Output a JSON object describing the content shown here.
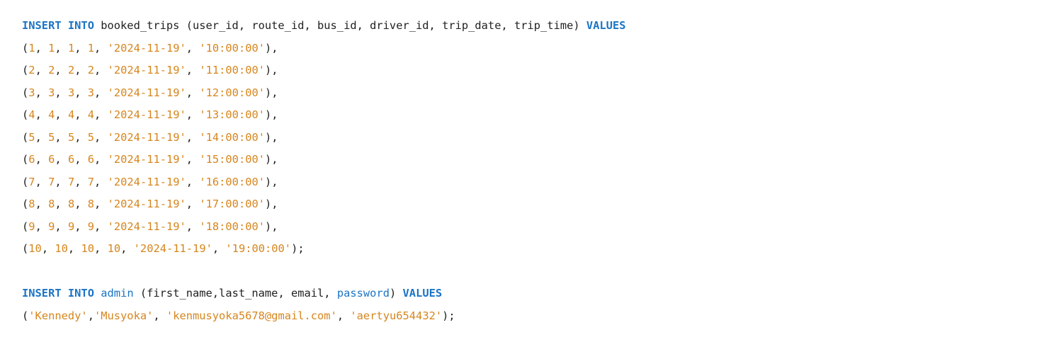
{
  "editor": {
    "lines": [
      [
        {
          "t": "INSERT",
          "k": "kw"
        },
        {
          "t": " ",
          "k": "plain"
        },
        {
          "t": "INTO",
          "k": "kw"
        },
        {
          "t": " booked_trips (user_id, route_id, bus_id, driver_id, trip_date, trip_time) ",
          "k": "plain"
        },
        {
          "t": "VALUES",
          "k": "kw"
        }
      ],
      [
        {
          "t": "(",
          "k": "punc"
        },
        {
          "t": "1",
          "k": "num"
        },
        {
          "t": ", ",
          "k": "punc"
        },
        {
          "t": "1",
          "k": "num"
        },
        {
          "t": ", ",
          "k": "punc"
        },
        {
          "t": "1",
          "k": "num"
        },
        {
          "t": ", ",
          "k": "punc"
        },
        {
          "t": "1",
          "k": "num"
        },
        {
          "t": ", ",
          "k": "punc"
        },
        {
          "t": "'2024-11-19'",
          "k": "str"
        },
        {
          "t": ", ",
          "k": "punc"
        },
        {
          "t": "'10:00:00'",
          "k": "str"
        },
        {
          "t": "),",
          "k": "punc"
        }
      ],
      [
        {
          "t": "(",
          "k": "punc"
        },
        {
          "t": "2",
          "k": "num"
        },
        {
          "t": ", ",
          "k": "punc"
        },
        {
          "t": "2",
          "k": "num"
        },
        {
          "t": ", ",
          "k": "punc"
        },
        {
          "t": "2",
          "k": "num"
        },
        {
          "t": ", ",
          "k": "punc"
        },
        {
          "t": "2",
          "k": "num"
        },
        {
          "t": ", ",
          "k": "punc"
        },
        {
          "t": "'2024-11-19'",
          "k": "str"
        },
        {
          "t": ", ",
          "k": "punc"
        },
        {
          "t": "'11:00:00'",
          "k": "str"
        },
        {
          "t": "),",
          "k": "punc"
        }
      ],
      [
        {
          "t": "(",
          "k": "punc"
        },
        {
          "t": "3",
          "k": "num"
        },
        {
          "t": ", ",
          "k": "punc"
        },
        {
          "t": "3",
          "k": "num"
        },
        {
          "t": ", ",
          "k": "punc"
        },
        {
          "t": "3",
          "k": "num"
        },
        {
          "t": ", ",
          "k": "punc"
        },
        {
          "t": "3",
          "k": "num"
        },
        {
          "t": ", ",
          "k": "punc"
        },
        {
          "t": "'2024-11-19'",
          "k": "str"
        },
        {
          "t": ", ",
          "k": "punc"
        },
        {
          "t": "'12:00:00'",
          "k": "str"
        },
        {
          "t": "),",
          "k": "punc"
        }
      ],
      [
        {
          "t": "(",
          "k": "punc"
        },
        {
          "t": "4",
          "k": "num"
        },
        {
          "t": ", ",
          "k": "punc"
        },
        {
          "t": "4",
          "k": "num"
        },
        {
          "t": ", ",
          "k": "punc"
        },
        {
          "t": "4",
          "k": "num"
        },
        {
          "t": ", ",
          "k": "punc"
        },
        {
          "t": "4",
          "k": "num"
        },
        {
          "t": ", ",
          "k": "punc"
        },
        {
          "t": "'2024-11-19'",
          "k": "str"
        },
        {
          "t": ", ",
          "k": "punc"
        },
        {
          "t": "'13:00:00'",
          "k": "str"
        },
        {
          "t": "),",
          "k": "punc"
        }
      ],
      [
        {
          "t": "(",
          "k": "punc"
        },
        {
          "t": "5",
          "k": "num"
        },
        {
          "t": ", ",
          "k": "punc"
        },
        {
          "t": "5",
          "k": "num"
        },
        {
          "t": ", ",
          "k": "punc"
        },
        {
          "t": "5",
          "k": "num"
        },
        {
          "t": ", ",
          "k": "punc"
        },
        {
          "t": "5",
          "k": "num"
        },
        {
          "t": ", ",
          "k": "punc"
        },
        {
          "t": "'2024-11-19'",
          "k": "str"
        },
        {
          "t": ", ",
          "k": "punc"
        },
        {
          "t": "'14:00:00'",
          "k": "str"
        },
        {
          "t": "),",
          "k": "punc"
        }
      ],
      [
        {
          "t": "(",
          "k": "punc"
        },
        {
          "t": "6",
          "k": "num"
        },
        {
          "t": ", ",
          "k": "punc"
        },
        {
          "t": "6",
          "k": "num"
        },
        {
          "t": ", ",
          "k": "punc"
        },
        {
          "t": "6",
          "k": "num"
        },
        {
          "t": ", ",
          "k": "punc"
        },
        {
          "t": "6",
          "k": "num"
        },
        {
          "t": ", ",
          "k": "punc"
        },
        {
          "t": "'2024-11-19'",
          "k": "str"
        },
        {
          "t": ", ",
          "k": "punc"
        },
        {
          "t": "'15:00:00'",
          "k": "str"
        },
        {
          "t": "),",
          "k": "punc"
        }
      ],
      [
        {
          "t": "(",
          "k": "punc"
        },
        {
          "t": "7",
          "k": "num"
        },
        {
          "t": ", ",
          "k": "punc"
        },
        {
          "t": "7",
          "k": "num"
        },
        {
          "t": ", ",
          "k": "punc"
        },
        {
          "t": "7",
          "k": "num"
        },
        {
          "t": ", ",
          "k": "punc"
        },
        {
          "t": "7",
          "k": "num"
        },
        {
          "t": ", ",
          "k": "punc"
        },
        {
          "t": "'2024-11-19'",
          "k": "str"
        },
        {
          "t": ", ",
          "k": "punc"
        },
        {
          "t": "'16:00:00'",
          "k": "str"
        },
        {
          "t": "),",
          "k": "punc"
        }
      ],
      [
        {
          "t": "(",
          "k": "punc"
        },
        {
          "t": "8",
          "k": "num"
        },
        {
          "t": ", ",
          "k": "punc"
        },
        {
          "t": "8",
          "k": "num"
        },
        {
          "t": ", ",
          "k": "punc"
        },
        {
          "t": "8",
          "k": "num"
        },
        {
          "t": ", ",
          "k": "punc"
        },
        {
          "t": "8",
          "k": "num"
        },
        {
          "t": ", ",
          "k": "punc"
        },
        {
          "t": "'2024-11-19'",
          "k": "str"
        },
        {
          "t": ", ",
          "k": "punc"
        },
        {
          "t": "'17:00:00'",
          "k": "str"
        },
        {
          "t": "),",
          "k": "punc"
        }
      ],
      [
        {
          "t": "(",
          "k": "punc"
        },
        {
          "t": "9",
          "k": "num"
        },
        {
          "t": ", ",
          "k": "punc"
        },
        {
          "t": "9",
          "k": "num"
        },
        {
          "t": ", ",
          "k": "punc"
        },
        {
          "t": "9",
          "k": "num"
        },
        {
          "t": ", ",
          "k": "punc"
        },
        {
          "t": "9",
          "k": "num"
        },
        {
          "t": ", ",
          "k": "punc"
        },
        {
          "t": "'2024-11-19'",
          "k": "str"
        },
        {
          "t": ", ",
          "k": "punc"
        },
        {
          "t": "'18:00:00'",
          "k": "str"
        },
        {
          "t": "),",
          "k": "punc"
        }
      ],
      [
        {
          "t": "(",
          "k": "punc"
        },
        {
          "t": "10",
          "k": "num"
        },
        {
          "t": ", ",
          "k": "punc"
        },
        {
          "t": "10",
          "k": "num"
        },
        {
          "t": ", ",
          "k": "punc"
        },
        {
          "t": "10",
          "k": "num"
        },
        {
          "t": ", ",
          "k": "punc"
        },
        {
          "t": "10",
          "k": "num"
        },
        {
          "t": ", ",
          "k": "punc"
        },
        {
          "t": "'2024-11-19'",
          "k": "str"
        },
        {
          "t": ", ",
          "k": "punc"
        },
        {
          "t": "'19:00:00'",
          "k": "str"
        },
        {
          "t": ");",
          "k": "punc"
        }
      ],
      [],
      [
        {
          "t": "INSERT",
          "k": "kw"
        },
        {
          "t": " ",
          "k": "plain"
        },
        {
          "t": "INTO",
          "k": "kw"
        },
        {
          "t": " ",
          "k": "plain"
        },
        {
          "t": "admin",
          "k": "id"
        },
        {
          "t": " (first_name,last_name, email, ",
          "k": "plain"
        },
        {
          "t": "password",
          "k": "id"
        },
        {
          "t": ") ",
          "k": "plain"
        },
        {
          "t": "VALUES",
          "k": "kw"
        }
      ],
      [
        {
          "t": "(",
          "k": "punc"
        },
        {
          "t": "'Kennedy'",
          "k": "str"
        },
        {
          "t": ",",
          "k": "punc"
        },
        {
          "t": "'Musyoka'",
          "k": "str"
        },
        {
          "t": ", ",
          "k": "punc"
        },
        {
          "t": "'kenmusyoka5678@gmail.com'",
          "k": "str"
        },
        {
          "t": ", ",
          "k": "punc"
        },
        {
          "t": "'aertyu654432'",
          "k": "str"
        },
        {
          "t": ");",
          "k": "punc"
        }
      ]
    ]
  }
}
